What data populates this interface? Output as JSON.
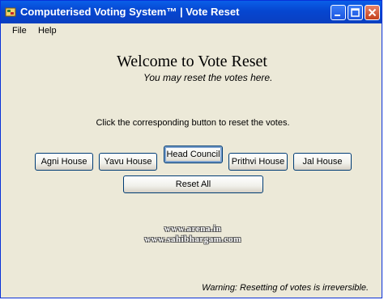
{
  "window": {
    "title": "Computerised Voting System™  |  Vote Reset"
  },
  "menu": {
    "file": "File",
    "help": "Help"
  },
  "main": {
    "heading": "Welcome to Vote Reset",
    "subheading": "You may reset the votes here.",
    "instructions": "Click the corresponding button to reset the votes."
  },
  "buttons": {
    "agni": "Agni House",
    "yavu": "Yavu House",
    "head_council": "Head Council",
    "prithvi": "Prithvi House",
    "jal": "Jal House",
    "reset_all": "Reset All"
  },
  "watermark": {
    "line1": "www.arena.in",
    "line2": "www.sahibhargam.com"
  },
  "footer": {
    "warning": "Warning: Resetting of votes is irreversible."
  },
  "colors": {
    "titlebar": "#0a5fe8",
    "window_bg": "#ece9d8",
    "button_border": "#003c74"
  },
  "icons": {
    "app": "app-icon",
    "minimize": "minimize-icon",
    "maximize": "maximize-icon",
    "close": "close-icon"
  }
}
